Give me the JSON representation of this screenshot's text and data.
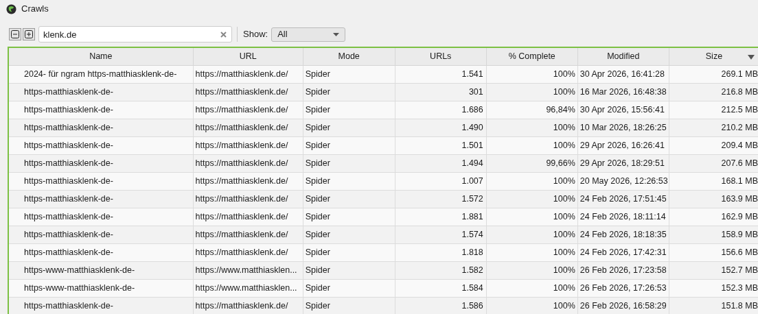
{
  "window": {
    "title": "Crawls"
  },
  "toolbar": {
    "search": {
      "value": "klenk.de"
    },
    "show_label": "Show:",
    "show_value": "All"
  },
  "table": {
    "columns": [
      {
        "label": "Name"
      },
      {
        "label": "URL"
      },
      {
        "label": "Mode"
      },
      {
        "label": "URLs"
      },
      {
        "label": "% Complete"
      },
      {
        "label": "Modified"
      },
      {
        "label": "Size",
        "sorted": true
      }
    ],
    "rows": [
      [
        "2024- für ngram https-matthiasklenk-de-",
        "https://matthiasklenk.de/",
        "Spider",
        "1.541",
        "100%",
        "30 Apr 2026, 16:41:28",
        "269.1 MB"
      ],
      [
        "https-matthiasklenk-de-",
        "https://matthiasklenk.de/",
        "Spider",
        "301",
        "100%",
        "16 Mar 2026, 16:48:38",
        "216.8 MB"
      ],
      [
        "https-matthiasklenk-de-",
        "https://matthiasklenk.de/",
        "Spider",
        "1.686",
        "96,84%",
        "30 Apr 2026, 15:56:41",
        "212.5 MB"
      ],
      [
        "https-matthiasklenk-de-",
        "https://matthiasklenk.de/",
        "Spider",
        "1.490",
        "100%",
        "10 Mar 2026, 18:26:25",
        "210.2 MB"
      ],
      [
        "https-matthiasklenk-de-",
        "https://matthiasklenk.de/",
        "Spider",
        "1.501",
        "100%",
        "29 Apr 2026, 16:26:41",
        "209.4 MB"
      ],
      [
        "https-matthiasklenk-de-",
        "https://matthiasklenk.de/",
        "Spider",
        "1.494",
        "99,66%",
        "29 Apr 2026, 18:29:51",
        "207.6 MB"
      ],
      [
        "https-matthiasklenk-de-",
        "https://matthiasklenk.de/",
        "Spider",
        "1.007",
        "100%",
        "20 May 2026, 12:26:53",
        "168.1 MB"
      ],
      [
        "https-matthiasklenk-de-",
        "https://matthiasklenk.de/",
        "Spider",
        "1.572",
        "100%",
        "24 Feb 2026, 17:51:45",
        "163.9 MB"
      ],
      [
        "https-matthiasklenk-de-",
        "https://matthiasklenk.de/",
        "Spider",
        "1.881",
        "100%",
        "24 Feb 2026, 18:11:14",
        "162.9 MB"
      ],
      [
        "https-matthiasklenk-de-",
        "https://matthiasklenk.de/",
        "Spider",
        "1.574",
        "100%",
        "24 Feb 2026, 18:18:35",
        "158.9 MB"
      ],
      [
        "https-matthiasklenk-de-",
        "https://matthiasklenk.de/",
        "Spider",
        "1.818",
        "100%",
        "24 Feb 2026, 17:42:31",
        "156.6 MB"
      ],
      [
        "https-www-matthiasklenk-de-",
        "https://www.matthiasklen...",
        "Spider",
        "1.582",
        "100%",
        "26 Feb 2026, 17:23:58",
        "152.7 MB"
      ],
      [
        "https-www-matthiasklenk-de-",
        "https://www.matthiasklen...",
        "Spider",
        "1.584",
        "100%",
        "26 Feb 2026, 17:26:53",
        "152.3 MB"
      ],
      [
        "https-matthiasklenk-de-",
        "https://matthiasklenk.de/",
        "Spider",
        "1.586",
        "100%",
        "26 Feb 2026, 16:58:29",
        "151.8 MB"
      ]
    ]
  }
}
